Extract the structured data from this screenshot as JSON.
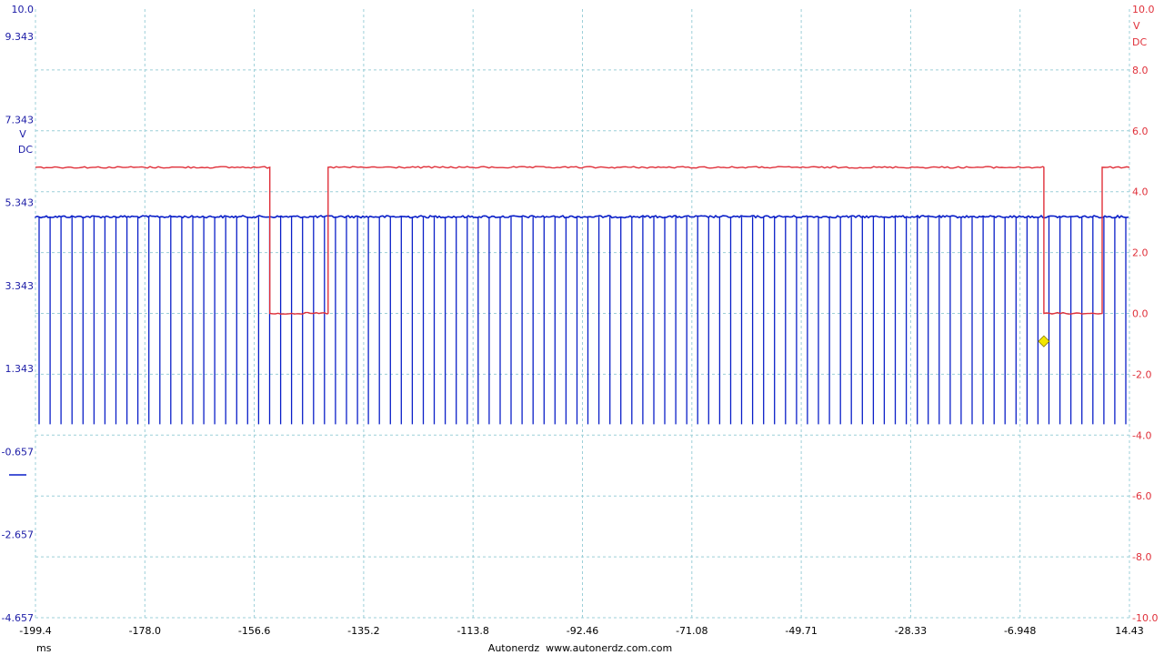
{
  "chart_data": {
    "type": "line",
    "footer_text": "Autonerdz  www.autonerdz.com.com",
    "xlabel": "ms",
    "xlim": [
      -199.4,
      14.43
    ],
    "x_tick_labels": [
      "-199.4",
      "-178.0",
      "-156.6",
      "-135.2",
      "-113.8",
      "-92.46",
      "-71.08",
      "-49.71",
      "-28.33",
      "-6.948",
      "14.43"
    ],
    "grid": true,
    "left_axis": {
      "unit": [
        "V",
        "DC"
      ],
      "ylim": [
        -4.657,
        10.0
      ],
      "tick_labels": [
        "10.0",
        "9.343",
        "7.343",
        "5.343",
        "3.343",
        "1.343",
        "-0.657",
        "-2.657",
        "-4.657"
      ],
      "tick_values": [
        10.0,
        9.343,
        7.343,
        5.343,
        3.343,
        1.343,
        -0.657,
        -2.657,
        -4.657
      ],
      "color": "#1a1aa6"
    },
    "right_axis": {
      "unit": [
        "V",
        "DC"
      ],
      "ylim": [
        -10.0,
        10.0
      ],
      "tick_labels": [
        "10.0",
        "8.0",
        "6.0",
        "4.0",
        "2.0",
        "0.0",
        "-2.0",
        "-4.0",
        "-6.0",
        "-8.0",
        "-10.0"
      ],
      "tick_values": [
        10.0,
        8.0,
        6.0,
        4.0,
        2.0,
        0.0,
        -2.0,
        -4.0,
        -6.0,
        -8.0,
        -10.0
      ],
      "color": "#e0303a"
    },
    "series": [
      {
        "axis": "right",
        "color": "#e0303a",
        "high": 4.8,
        "low": 0.0,
        "low_pulses": [
          [
            -153.6,
            -142.2
          ],
          [
            -2.3,
            9.1
          ]
        ]
      },
      {
        "axis": "left",
        "color": "#0a1fc8",
        "baseline": 5.0,
        "spike_min": 0.0,
        "spike_count": 100,
        "marker_x": -2.3,
        "marker_y": 2.0,
        "marker_color": "#f2e600"
      }
    ]
  }
}
